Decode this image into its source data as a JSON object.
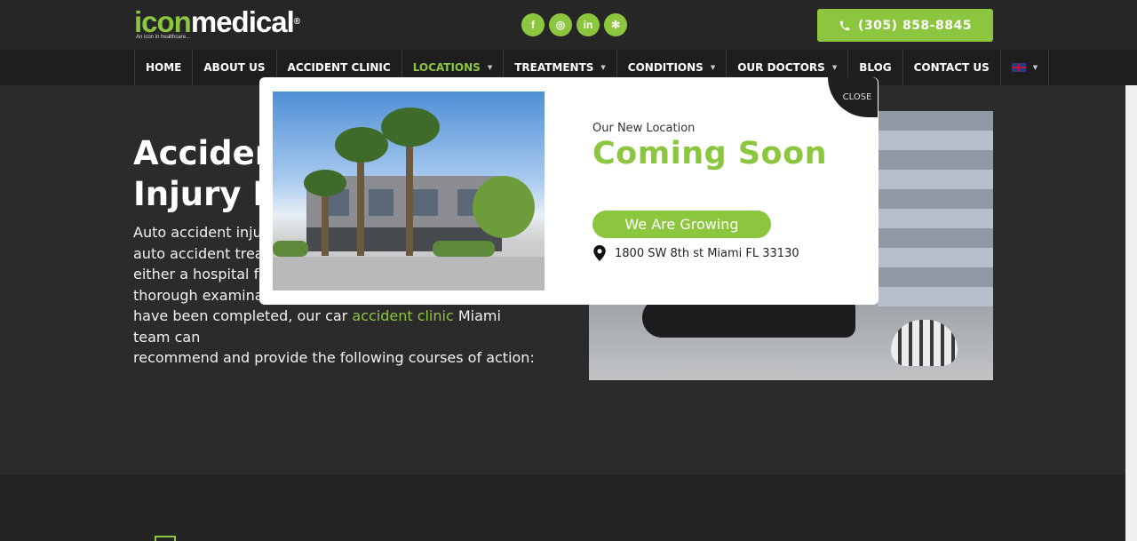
{
  "header": {
    "logo_main_a": "icon",
    "logo_main_b": "medical",
    "logo_reg": "®",
    "logo_tagline": "An icon in healthcare...",
    "socials": [
      {
        "icon": "facebook-icon",
        "glyph": "f"
      },
      {
        "icon": "instagram-icon",
        "glyph": "◎"
      },
      {
        "icon": "linkedin-icon",
        "glyph": "in"
      },
      {
        "icon": "yelp-icon",
        "glyph": "✻"
      }
    ],
    "phone": "(305) 858-8845"
  },
  "nav": {
    "items": [
      {
        "label": "HOME"
      },
      {
        "label": "ABOUT US"
      },
      {
        "label": "ACCIDENT CLINIC"
      },
      {
        "label": "LOCATIONS"
      },
      {
        "label": "TREATMENTS"
      },
      {
        "label": "CONDITIONS"
      },
      {
        "label": "OUR DOCTORS"
      },
      {
        "label": "BLOG"
      },
      {
        "label": "CONTACT US"
      }
    ],
    "caret": "▼"
  },
  "hero": {
    "title_line1": "Acciden",
    "title_line2": "Injury Di",
    "body_lines": [
      "Auto accident injuri",
      "auto accident treat",
      "either a hospital fac",
      "thorough examinatio"
    ],
    "body_tail_prefix": "have been completed, our car ",
    "body_link": "accident clinic",
    "body_tail_suffix": " Miami team can",
    "body_last": "recommend and provide the following courses of action:"
  },
  "modal": {
    "subtitle": "Our New Location",
    "title": "Coming Soon",
    "button": "We Are Growing",
    "address": "1800 SW 8th st Miami FL 33130",
    "close": "CLOSE"
  },
  "colors": {
    "accent": "#8cc63f",
    "nav_bg": "#1e1e1e",
    "page_bg": "#2b2b2b"
  }
}
